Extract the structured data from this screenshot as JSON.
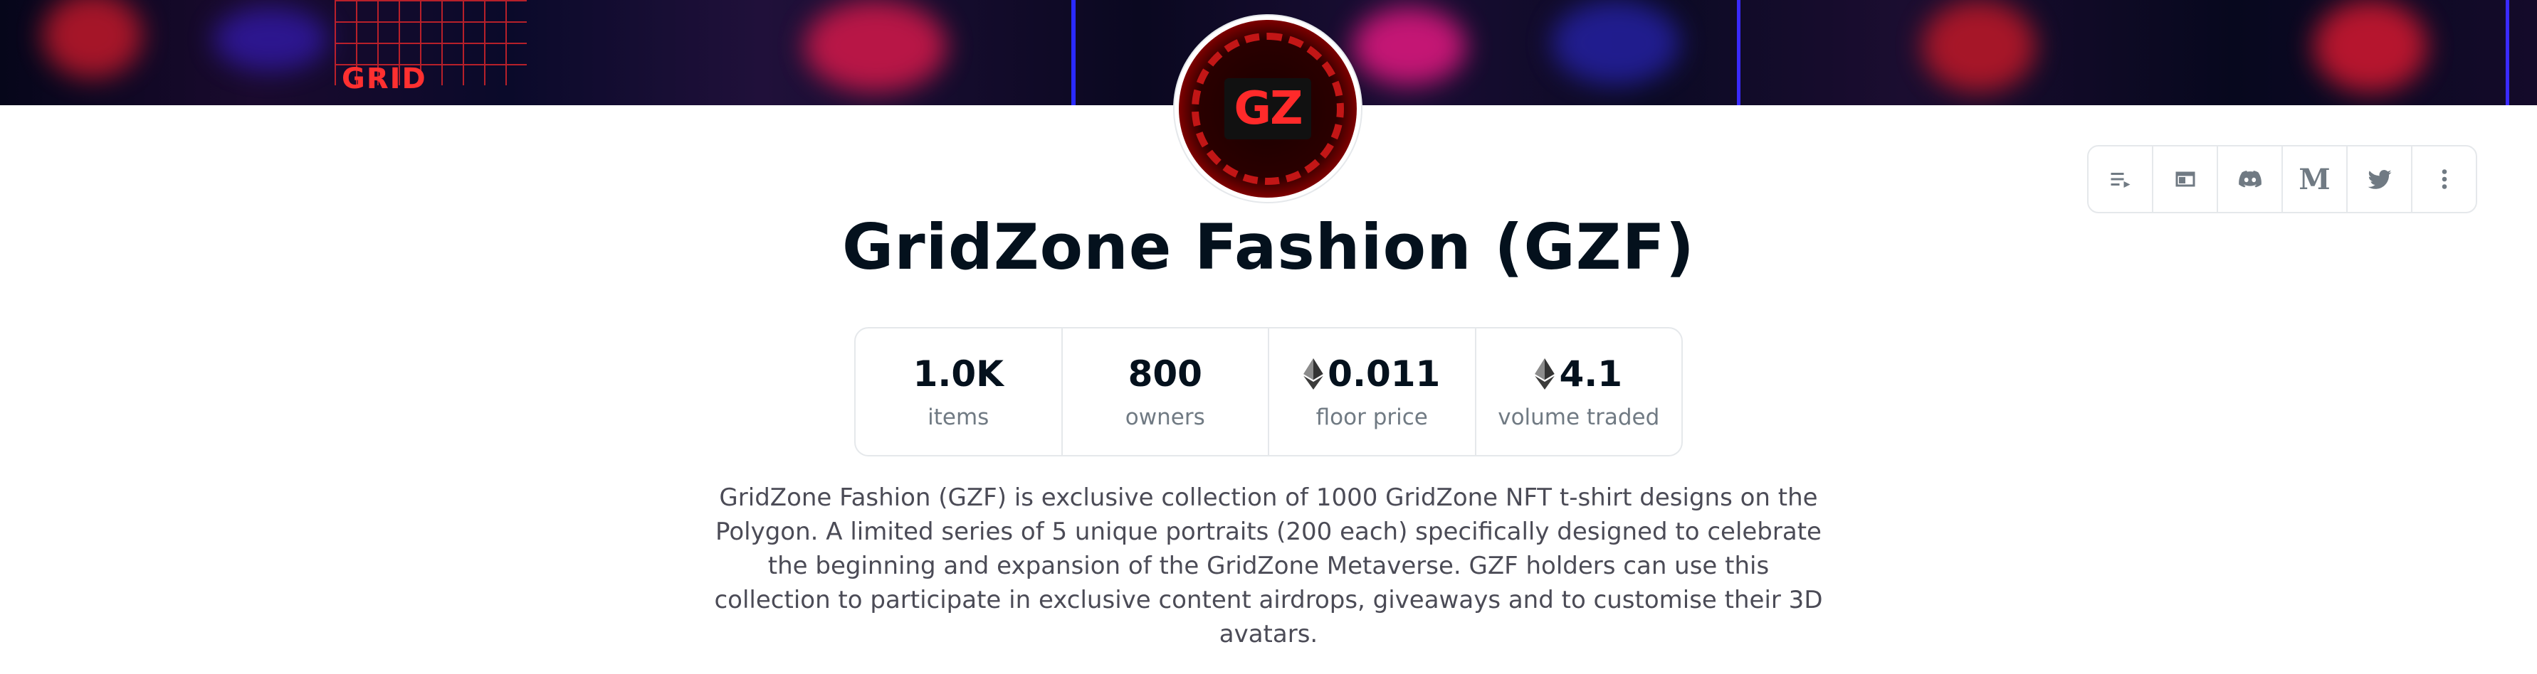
{
  "collection": {
    "title": "GridZone Fashion (GZF)",
    "avatar_text": "GZ",
    "banner_text": "GRID",
    "description": "GridZone Fashion (GZF) is exclusive collection of 1000 GridZone NFT t-shirt designs on the Polygon. A limited series of 5 unique portraits (200 each) specifically designed to celebrate the beginning and expansion of the GridZone Metaverse. GZF holders can use this collection to participate in exclusive content airdrops, giveaways and to customise their 3D avatars."
  },
  "stats": [
    {
      "value": "1.0K",
      "label": "items",
      "currency_icon": false
    },
    {
      "value": "800",
      "label": "owners",
      "currency_icon": false
    },
    {
      "value": "0.011",
      "label": "floor price",
      "currency_icon": true
    },
    {
      "value": "4.1",
      "label": "volume traded",
      "currency_icon": true
    }
  ],
  "toolbar": {
    "icons": [
      "activity-icon",
      "website-icon",
      "discord-icon",
      "medium-icon",
      "twitter-icon",
      "more-icon"
    ],
    "medium_letter": "M"
  },
  "colors": {
    "text_primary": "#04111d",
    "text_secondary": "#707a83",
    "border": "#e5e8eb",
    "accent_red": "#ff2a2a"
  }
}
